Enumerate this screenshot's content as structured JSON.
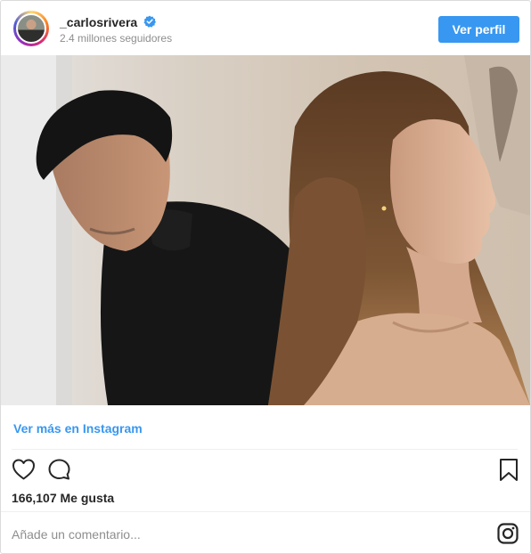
{
  "post": {
    "username": "_carlosrivera",
    "followers": "2.4 millones seguidores",
    "profile_button": "Ver perfil",
    "view_more": "Ver más en Instagram",
    "likes": "166,107 Me gusta",
    "comment_placeholder": "Añade un comentario..."
  },
  "colors": {
    "accent": "#3897f0",
    "text": "#262626",
    "muted": "#8e8e8e",
    "border": "#dbdbdb"
  },
  "icons": [
    "verified-badge-icon",
    "heart-icon",
    "comment-icon",
    "bookmark-icon",
    "instagram-logo-icon"
  ]
}
